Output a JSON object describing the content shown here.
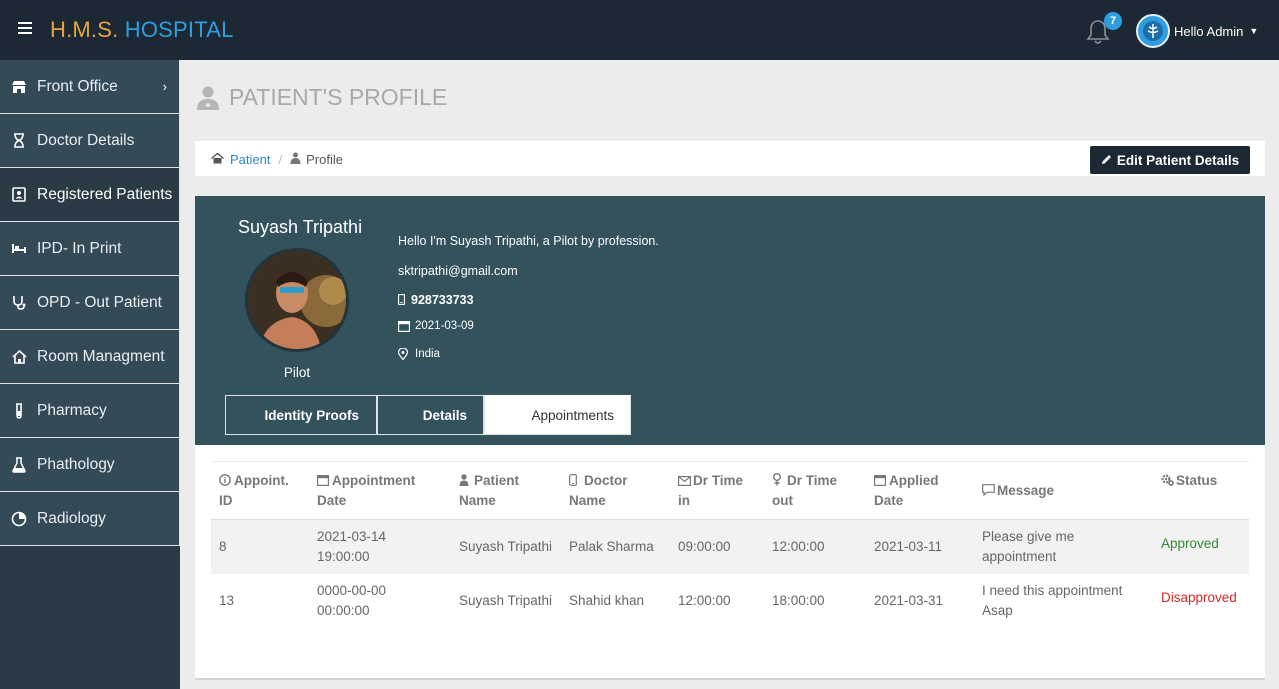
{
  "topbar": {
    "brand_part1": "H.M.S.",
    "brand_part2": "HOSPITAL",
    "notification_count": "7",
    "user_greeting": "Hello Admin"
  },
  "sidebar": {
    "items": [
      {
        "label": "Front Office",
        "icon": "store-icon"
      },
      {
        "label": "Doctor Details",
        "icon": "hourglass-icon"
      },
      {
        "label": "Registered Patients",
        "icon": "id-card-icon"
      },
      {
        "label": "IPD- In Print",
        "icon": "bed-icon"
      },
      {
        "label": "OPD - Out Patient",
        "icon": "stethoscope-icon"
      },
      {
        "label": "Room Managment",
        "icon": "home-icon"
      },
      {
        "label": "Pharmacy",
        "icon": "test-tube-icon"
      },
      {
        "label": "Phathology",
        "icon": "flask-icon"
      },
      {
        "label": "Radiology",
        "icon": "pie-chart-icon"
      }
    ]
  },
  "page": {
    "title": "PATIENT'S PROFILE",
    "breadcrumb": {
      "root": "Patient",
      "separator": "/",
      "current": "Profile"
    },
    "edit_button": "Edit Patient Details"
  },
  "patient": {
    "name": "Suyash Tripathi",
    "profession": "Pilot",
    "bio": "Hello I'm Suyash Tripathi, a Pilot by profession.",
    "email": "sktripathi@gmail.com",
    "phone": "928733733",
    "date": "2021-03-09",
    "country": "India"
  },
  "tabs": [
    {
      "label": "Identity Proofs"
    },
    {
      "label": "Details"
    },
    {
      "label": "Appointments"
    }
  ],
  "appointments": {
    "headers": [
      {
        "line1": "Appoint.",
        "line2": "ID",
        "icon": "info-circle-icon"
      },
      {
        "line1": "Appointment",
        "line2": "Date",
        "icon": "calendar-icon"
      },
      {
        "line1": "Patient",
        "line2": "Name",
        "icon": "user-icon"
      },
      {
        "line1": "Doctor",
        "line2": "Name",
        "icon": "mobile-icon"
      },
      {
        "line1": "Dr Time",
        "line2": "in",
        "icon": "envelope-icon"
      },
      {
        "line1": "Dr Time",
        "line2": "out",
        "icon": "female-icon"
      },
      {
        "line1": "Applied",
        "line2": "Date",
        "icon": "calendar-icon"
      },
      {
        "line1": "Message",
        "line2": "",
        "icon": "comment-icon"
      },
      {
        "line1": "Status",
        "line2": "",
        "icon": "cogs-icon"
      }
    ],
    "rows": [
      {
        "id": "8",
        "date1": "2021-03-14",
        "date2": "19:00:00",
        "patient": "Suyash Tripathi",
        "doctor": "Palak Sharma",
        "time_in": "09:00:00",
        "time_out": "12:00:00",
        "applied": "2021-03-11",
        "msg1": "Please give me",
        "msg2": "appointment",
        "status": "Approved"
      },
      {
        "id": "13",
        "date1": "0000-00-00",
        "date2": "00:00:00",
        "patient": "Suyash Tripathi",
        "doctor": "Shahid khan",
        "time_in": "12:00:00",
        "time_out": "18:00:00",
        "applied": "2021-03-31",
        "msg1": "I need this appointment",
        "msg2": "Asap",
        "status": "Disapproved"
      }
    ]
  },
  "colors": {
    "topbar": "#1c2833",
    "sidebar": "#344a56",
    "profile_panel": "#34525c",
    "brand_orange": "#e8a33d",
    "brand_blue": "#2e9ee0",
    "approved": "#2e8b2e",
    "disapproved": "#d62828"
  }
}
